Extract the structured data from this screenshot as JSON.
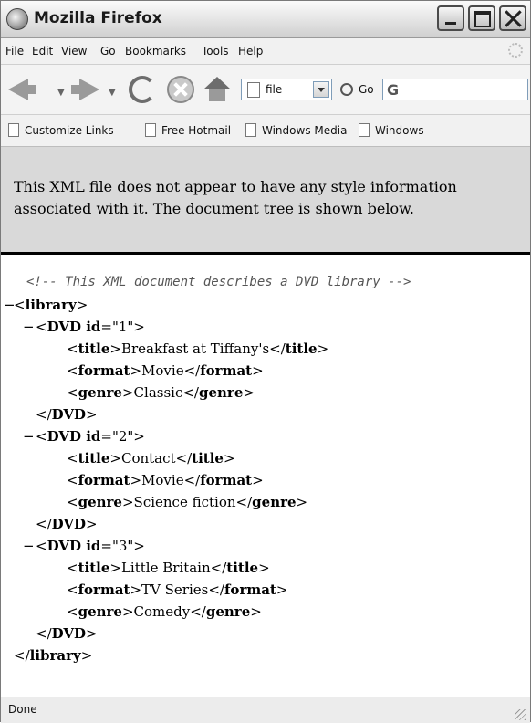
{
  "window": {
    "title": "Mozilla Firefox"
  },
  "menu": [
    "File",
    "Edit",
    "View",
    "Go",
    "Bookmarks",
    "Tools",
    "Help"
  ],
  "toolbar": {
    "url_value": "file",
    "go_label": "Go",
    "search_engine_glyph": "G"
  },
  "bookmarks": [
    "Customize Links",
    "Free Hotmail",
    "Windows Media",
    "Windows"
  ],
  "info": {
    "text": "This XML file does not appear to have any style information associated with it. The document tree is shown below."
  },
  "xml": {
    "comment": "<!-- This XML document describes a DVD library -->",
    "root_tag": "library",
    "dvds": [
      {
        "id": "1",
        "title": "Breakfast at Tiffany's",
        "format": "Movie",
        "genre": "Classic"
      },
      {
        "id": "2",
        "title": "Contact",
        "format": "Movie",
        "genre": "Science fiction"
      },
      {
        "id": "3",
        "title": "Little Britain",
        "format": "TV Series",
        "genre": "Comedy"
      }
    ]
  },
  "status": {
    "text": "Done"
  },
  "colors": {
    "info_background": "#d9d9d9",
    "comment_text": "#555555"
  }
}
